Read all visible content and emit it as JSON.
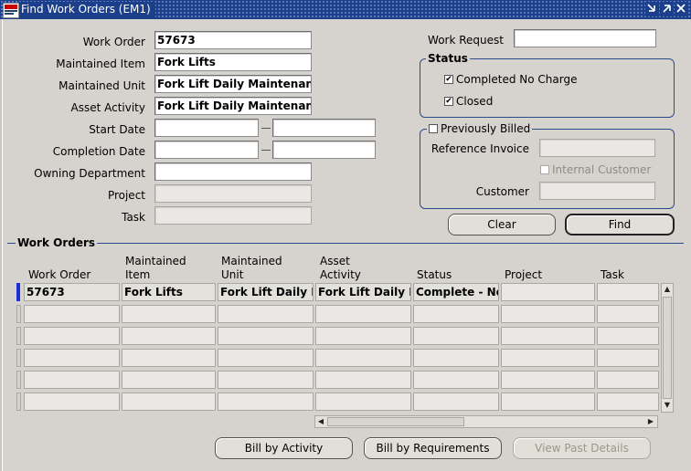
{
  "window": {
    "title": "Find Work Orders (EM1)"
  },
  "form": {
    "work_order": {
      "label": "Work Order",
      "value": "57673"
    },
    "maintained_item": {
      "label": "Maintained Item",
      "value": "Fork Lifts"
    },
    "maintained_unit": {
      "label": "Maintained Unit",
      "value": "Fork Lift Daily Maintenance"
    },
    "asset_activity": {
      "label": "Asset Activity",
      "value": "Fork Lift Daily Maintenance"
    },
    "start_date": {
      "label": "Start Date",
      "from": "",
      "to": ""
    },
    "completion_date": {
      "label": "Completion Date",
      "from": "",
      "to": ""
    },
    "owning_department": {
      "label": "Owning Department",
      "value": ""
    },
    "project": {
      "label": "Project",
      "value": ""
    },
    "task": {
      "label": "Task",
      "value": ""
    },
    "work_request": {
      "label": "Work Request",
      "value": ""
    }
  },
  "status_group": {
    "legend": "Status",
    "completed_no_charge": {
      "label": "Completed No Charge",
      "checked": true
    },
    "closed": {
      "label": "Closed",
      "checked": true
    }
  },
  "billing_group": {
    "legend": "Previously Billed",
    "reference_invoice": {
      "label": "Reference Invoice",
      "value": ""
    },
    "internal_customer": {
      "label": "Internal Customer",
      "checked": false
    },
    "customer": {
      "label": "Customer",
      "value": ""
    }
  },
  "buttons": {
    "clear": "Clear",
    "find": "Find",
    "bill_by_activity": "Bill by Activity",
    "bill_by_requirements": "Bill by Requirements",
    "view_past_details": "View Past Details"
  },
  "results": {
    "section_title": "Work Orders",
    "columns": [
      "Work Order",
      "Maintained\nItem",
      "Maintained\nUnit",
      "Asset\nActivity",
      "Status",
      "Project",
      "Task"
    ],
    "rows": [
      [
        "57673",
        "Fork Lifts",
        "Fork Lift Daily M",
        "Fork Lift Daily M",
        "Complete - No",
        "",
        ""
      ],
      [
        "",
        "",
        "",
        "",
        "",
        "",
        ""
      ],
      [
        "",
        "",
        "",
        "",
        "",
        "",
        ""
      ],
      [
        "",
        "",
        "",
        "",
        "",
        "",
        ""
      ],
      [
        "",
        "",
        "",
        "",
        "",
        "",
        ""
      ],
      [
        "",
        "",
        "",
        "",
        "",
        "",
        ""
      ]
    ]
  },
  "icons": {
    "title_controls": [
      "minimize-icon",
      "maximize-icon",
      "close-icon"
    ],
    "check_glyph": "✔"
  },
  "colors": {
    "titlebar": "#1c3f8c",
    "accent": "#2b4a8b",
    "current_row": "#1a2fd8"
  }
}
